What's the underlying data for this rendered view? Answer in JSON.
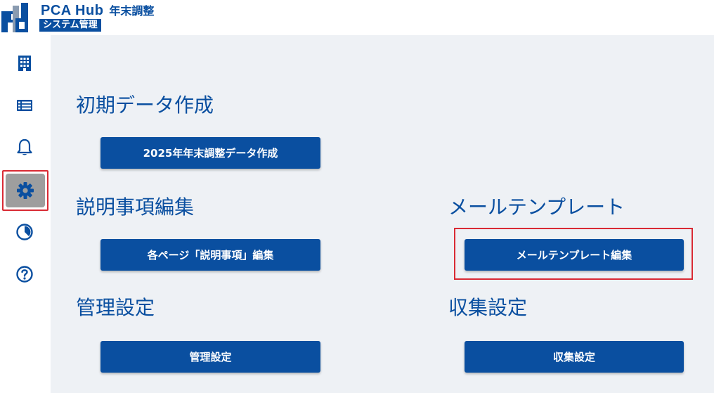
{
  "header": {
    "brand_name": "PCA Hub",
    "product_name": "年末調整",
    "subtitle": "システム管理"
  },
  "sidebar": {
    "items": [
      {
        "icon": "building-icon",
        "active": false
      },
      {
        "icon": "list-icon",
        "active": false
      },
      {
        "icon": "bell-icon",
        "active": false
      },
      {
        "icon": "gear-icon",
        "active": true
      },
      {
        "icon": "pie-chart-icon",
        "active": false
      },
      {
        "icon": "help-icon",
        "active": false
      }
    ]
  },
  "sections": {
    "initial_data": {
      "title": "初期データ作成",
      "button_label": "2025年年末調整データ作成"
    },
    "explanation": {
      "title": "説明事項編集",
      "button_label": "各ページ「説明事項」編集"
    },
    "mail_template": {
      "title": "メールテンプレート",
      "button_label": "メールテンプレート編集"
    },
    "admin_settings": {
      "title": "管理設定",
      "button_label": "管理設定"
    },
    "collection_settings": {
      "title": "収集設定",
      "button_label": "収集設定"
    }
  },
  "colors": {
    "brand": "#0a4fa0",
    "background": "#eef1f5",
    "highlight": "#d92a34",
    "active_nav": "#9e9e9e"
  }
}
